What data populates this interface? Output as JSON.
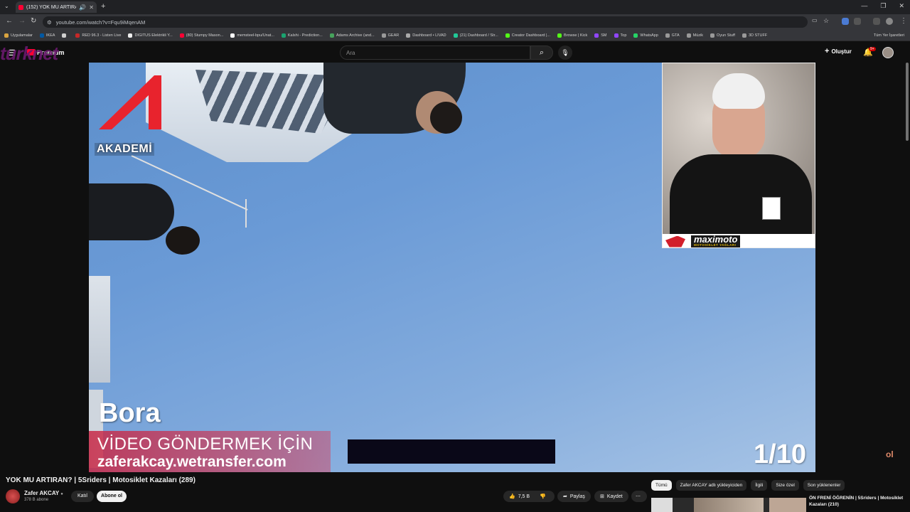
{
  "browser": {
    "tab_title": "(152) YOK MU ARTIRAN? |",
    "url": "youtube.com/watch?v=Fqu9iMqenAM",
    "bookmarks": [
      {
        "label": "Uygulamalar",
        "color": "#d9a440"
      },
      {
        "label": "IKEA",
        "color": "#0058a3"
      },
      {
        "label": "",
        "color": "#cfcfcf"
      },
      {
        "label": "RED 96.3 - Listen Live",
        "color": "#c62828"
      },
      {
        "label": "DIGITUS Elektrikli Y...",
        "color": "#eeeeee"
      },
      {
        "label": "(80) Stumpy Mason...",
        "color": "#ff0033"
      },
      {
        "label": "memsteel-bpu/Unat...",
        "color": "#ffffff"
      },
      {
        "label": "Kalshi - Prediction...",
        "color": "#1aa36f"
      },
      {
        "label": "Adams Archive (and...",
        "color": "#46a35c"
      },
      {
        "label": "GEAR",
        "color": "#999999"
      },
      {
        "label": "Dashboard • LIVAD",
        "color": "#aaaaaa"
      },
      {
        "label": "(21) Dashboard / Str...",
        "color": "#20c997"
      },
      {
        "label": "Creator Dashboard |...",
        "color": "#53fc18"
      },
      {
        "label": "Browse | Kick",
        "color": "#53fc18"
      },
      {
        "label": "SM",
        "color": "#9146ff"
      },
      {
        "label": "Top",
        "color": "#9146ff"
      },
      {
        "label": "WhatsApp",
        "color": "#25d366"
      },
      {
        "label": "GTA",
        "color": "#999999"
      },
      {
        "label": "Müzik",
        "color": "#999999"
      },
      {
        "label": "Oyun Stuff",
        "color": "#999999"
      },
      {
        "label": "3D STUFF",
        "color": "#999999"
      }
    ],
    "all_bookmarks": "Tüm Yer İşaretleri"
  },
  "youtube": {
    "logo_text": "Premium",
    "overlay_brand": "turknet",
    "search_placeholder": "Ara",
    "create_label": "Oluştur",
    "notification_count": "9+"
  },
  "video": {
    "akademi_label": "AKADEMİ",
    "rider_name": "Bora",
    "send_text": "VİDEO GÖNDERMEK İÇİN",
    "send_url": "zaferakcay.wetransfer.com",
    "counter": "1/10",
    "pip_brand": "maximoto",
    "pip_brand_sub": "MOTOSİKLET YAĞLARI",
    "corner_logo": "ol"
  },
  "below": {
    "title": "YOK MU ARTIRAN? | 5Sriders | Motosiklet Kazaları (289)",
    "channel_name": "Zafer AKCAY",
    "subscribers": "378 B abone",
    "join_label": "Katıl",
    "subscribe_label": "Abone ol",
    "likes": "7,5 B",
    "share_label": "Paylaş",
    "save_label": "Kaydet"
  },
  "chips": [
    "Tümü",
    "Zafer AKCAY adlı yükleyiciden",
    "İlgili",
    "Size özel",
    "Son yüklenenler"
  ],
  "recommendation": {
    "title": "ÖN FRENİ ÖĞRENİN | 5Sriders | Motosiklet Kazaları (210)"
  }
}
